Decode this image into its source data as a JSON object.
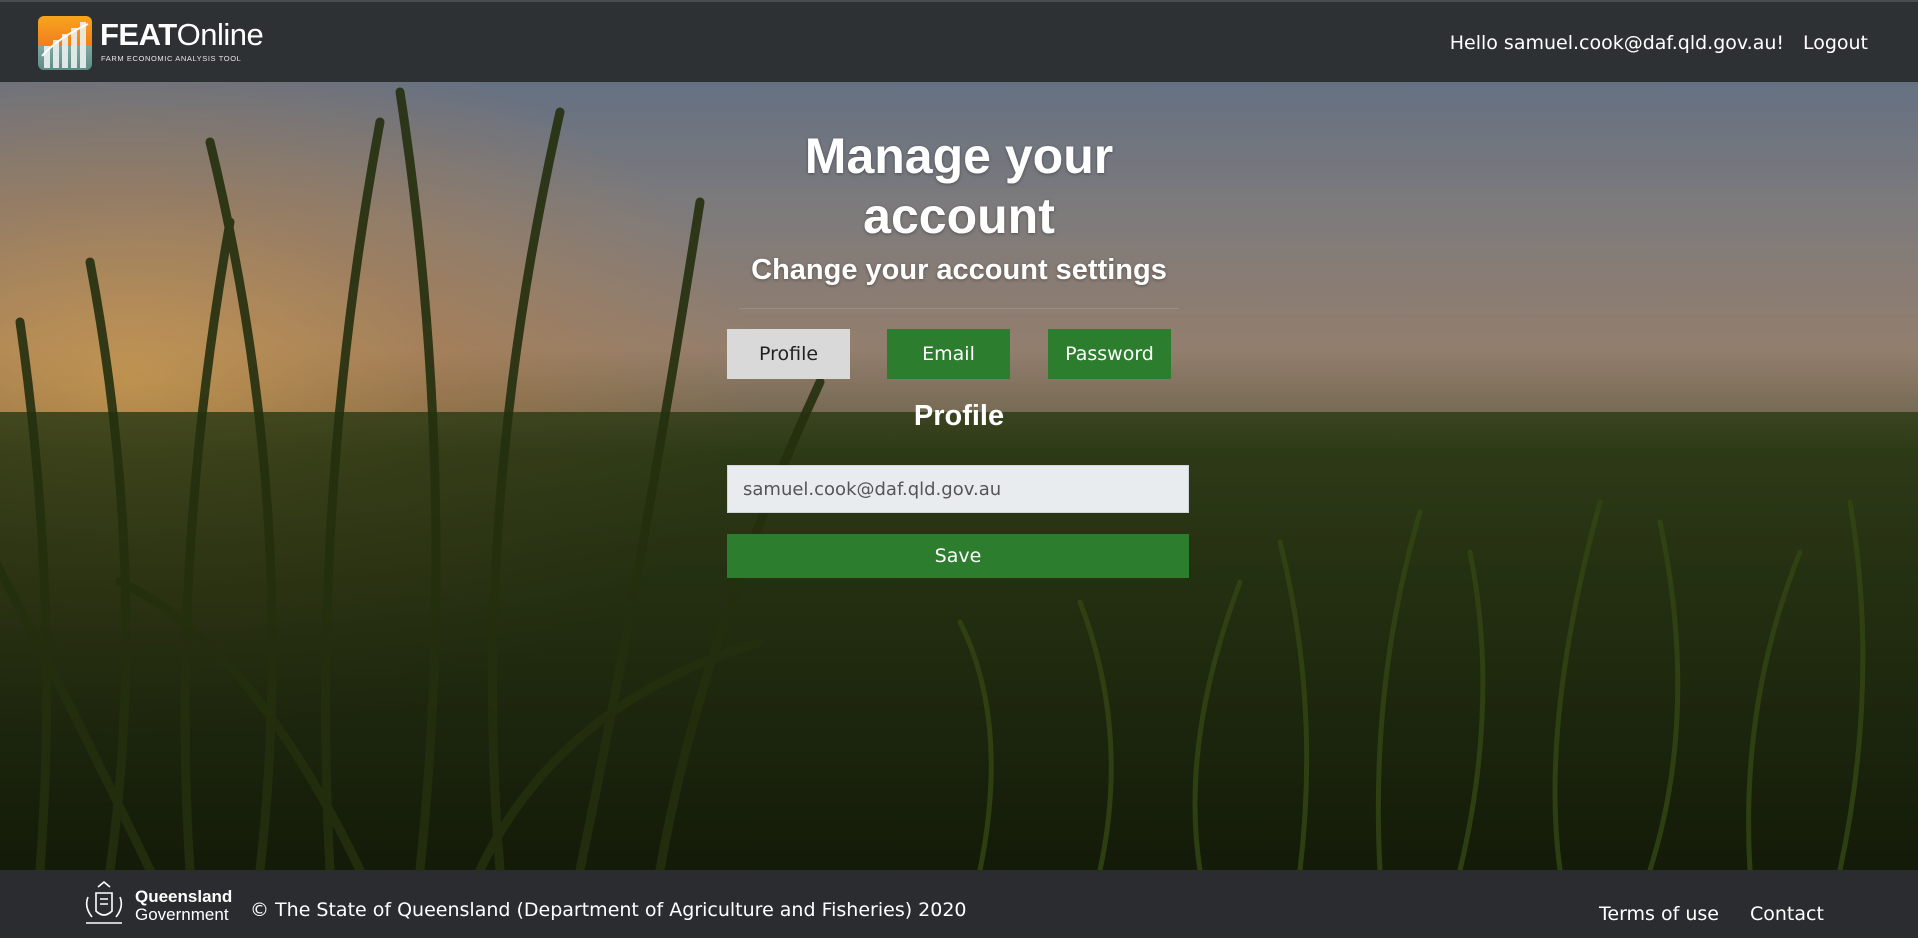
{
  "header": {
    "logo": {
      "title_bold": "FEAT",
      "title_regular": "Online",
      "subtitle": "FARM ECONOMIC ANALYSIS TOOL",
      "icon": "bar-chart-logo-icon"
    },
    "greeting": "Hello samuel.cook@daf.qld.gov.au!",
    "logout_label": "Logout"
  },
  "main": {
    "title": "Manage your account",
    "subtitle": "Change your account settings",
    "tabs": [
      {
        "label": "Profile",
        "active": true
      },
      {
        "label": "Email",
        "active": false
      },
      {
        "label": "Password",
        "active": false
      }
    ],
    "section_title": "Profile",
    "email_field": {
      "value": "samuel.cook@daf.qld.gov.au",
      "readonly": true
    },
    "save_label": "Save"
  },
  "footer": {
    "gov_name": "Queensland",
    "gov_sub": "Government",
    "crest_icon": "queensland-crest-icon",
    "copyright": "© The State of Queensland (Department of Agriculture and Fisheries) 2020",
    "links": [
      {
        "label": "Terms of use"
      },
      {
        "label": "Contact"
      }
    ]
  },
  "colors": {
    "header_bg": "#2e3134",
    "footer_bg": "#2a2c2f",
    "accent_green": "#2d7d2e",
    "tab_active_bg": "#d9d9d9",
    "input_bg": "#e9ecef"
  }
}
